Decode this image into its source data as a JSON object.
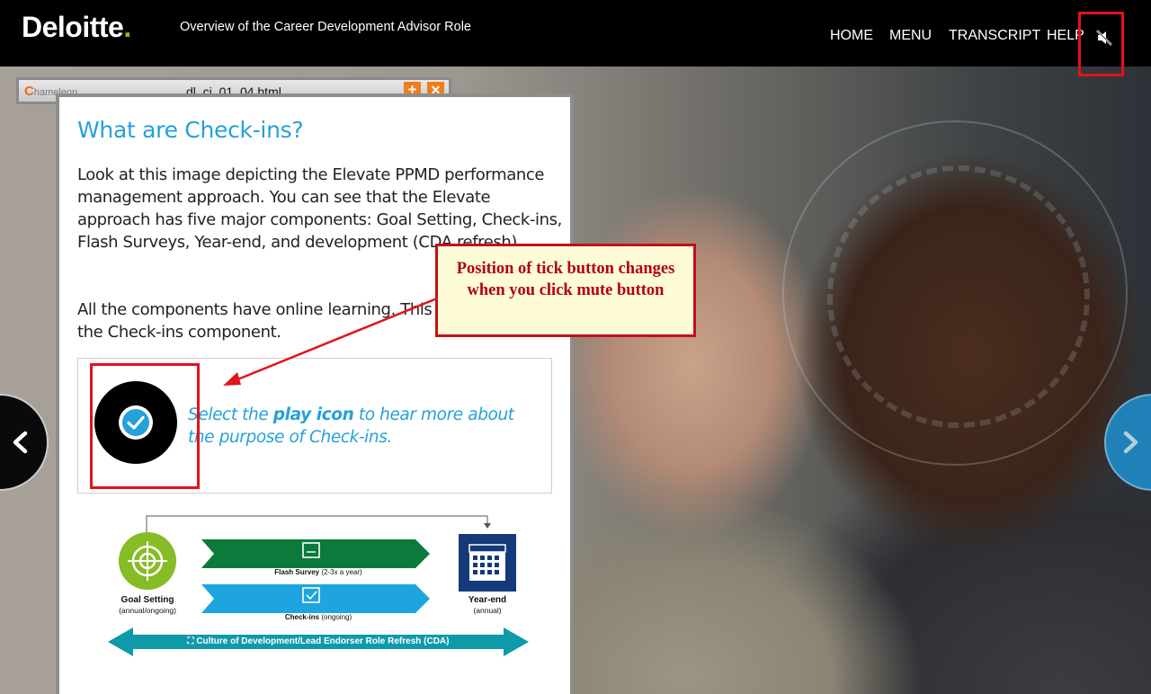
{
  "header": {
    "logo_text": "Deloitte",
    "logo_dot": ".",
    "course_title": "Overview of the Career Development Advisor Role",
    "nav": [
      "HOME",
      "MENU",
      "TRANSCRIPT",
      "HELP"
    ],
    "mute_icon": "speaker-muted-icon"
  },
  "window": {
    "logo_c": "C",
    "logo_rest": "hameleon",
    "filename": "dl_ci_01_04.html",
    "expand_label": "+",
    "close_label": "✕"
  },
  "panel": {
    "title": "What are Check-ins?",
    "paragraph1": "Look at this image depicting the Elevate PPMD performance management approach. You can see that the Elevate approach has five major components: Goal Setting, Check-ins, Flash Surveys, Year-end, and development (CDA refresh).",
    "paragraph2": "All the components have online learning. This is focused on the Check-ins component.",
    "play_prompt": {
      "pre": "Select the ",
      "bold": "play icon",
      "post": " to hear more about the purpose of Check-ins."
    }
  },
  "diagram": {
    "goal_setting": "Goal Setting",
    "goal_setting_sub": "(annual/ongoing)",
    "flash_survey": "Flash Survey",
    "flash_survey_sub": "(2-3x a year)",
    "checkins": "Check-ins",
    "checkins_sub": "(ongoing)",
    "year_end": "Year-end",
    "year_end_sub": "(annual)",
    "culture_bar": "Culture of Development/Lead Endorser Role Refresh (CDA)",
    "colors": {
      "green": "#86bc25",
      "dark_green": "#0b7a3b",
      "blue": "#1ea5e0",
      "navy": "#143a7a",
      "teal": "#0f9aaa"
    }
  },
  "callout": {
    "text": "Position of tick button changes when you click mute button"
  },
  "colors": {
    "accent_blue": "#26a0d8",
    "highlight_red": "#e2121b",
    "deloitte_green": "#86bc25"
  }
}
